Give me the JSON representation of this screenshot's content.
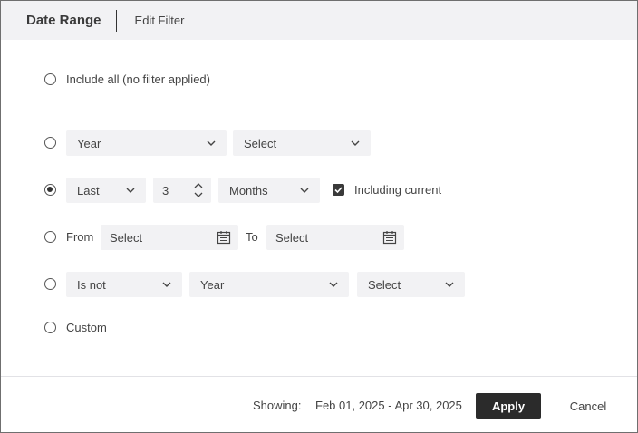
{
  "header": {
    "title": "Date Range",
    "tab": "Edit Filter"
  },
  "options": {
    "include_all": {
      "label": "Include all (no filter applied)",
      "selected": false
    },
    "year_select": {
      "selected": false,
      "period": "Year",
      "value": "Select"
    },
    "last": {
      "selected": true,
      "mode": "Last",
      "count": "3",
      "unit": "Months",
      "including_current": {
        "label": "Including current",
        "checked": true
      }
    },
    "range": {
      "selected": false,
      "from_label": "From",
      "from_value": "Select",
      "to_label": "To",
      "to_value": "Select"
    },
    "is_not": {
      "selected": false,
      "operator": "Is not",
      "period": "Year",
      "value": "Select"
    },
    "custom": {
      "label": "Custom",
      "selected": false
    }
  },
  "footer": {
    "showing_label": "Showing:",
    "showing_value": "Feb 01, 2025 - Apr 30, 2025",
    "apply_label": "Apply",
    "cancel_label": "Cancel"
  },
  "icons": {
    "dropdown": "chevron-down-icon",
    "calendar": "calendar-icon",
    "spinner": "stepper-arrows-icon",
    "check": "check-icon"
  },
  "colors": {
    "header_bg": "#f2f2f4",
    "control_bg": "#f2f2f4",
    "primary_button": "#2b2b2b"
  }
}
